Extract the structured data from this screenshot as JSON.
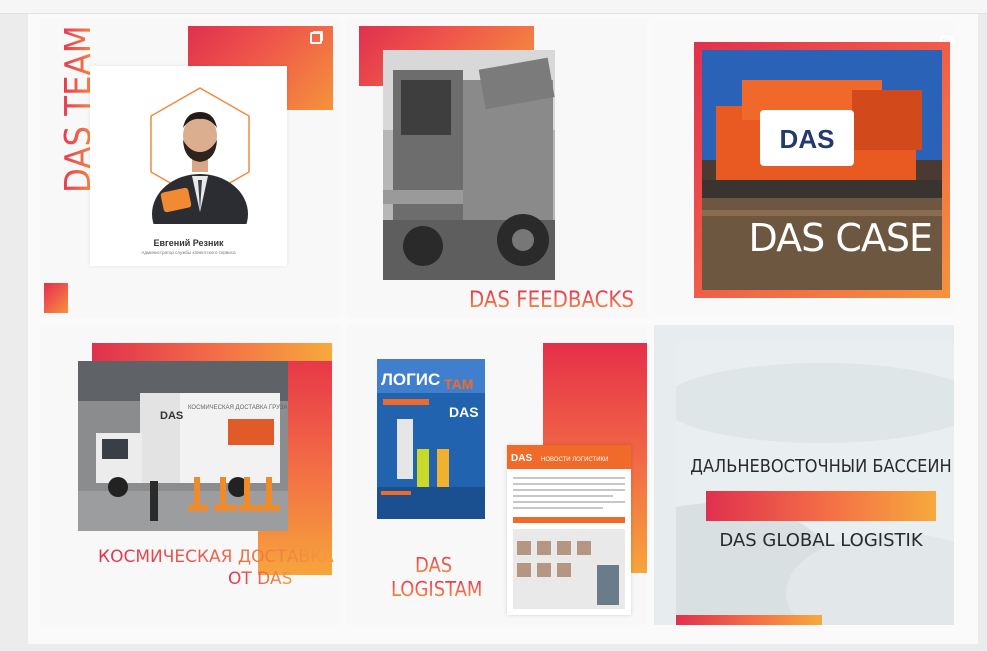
{
  "tiles": [
    {
      "title": "DAS TEAM",
      "person_name": "Евгений Резник",
      "person_role": "Администратор службы клиентского сервиса"
    },
    {
      "title": "DAS FEEDBACKS"
    },
    {
      "title": "DAS CASE",
      "banner_text": "DAS"
    },
    {
      "title_line1": "КОСМИЧЕСКАЯ ДОСТАВКА",
      "title_line2": "ОТ DAS",
      "truck_brand": "DAS",
      "truck_text": "КОСМИЧЕСКАЯ ДОСТАВКА ГРУЗА"
    },
    {
      "title_line1": "DAS",
      "title_line2": "LOGISTAM",
      "magazine_title_a": "ЛОГИС",
      "magazine_title_b": "ТАМ",
      "magazine_brand": "DAS",
      "news_brand": "DAS",
      "news_title": "НОВОСТИ ЛОГИСТИКИ"
    },
    {
      "line1": "ДАЛЬНЕВОСТОЧНЫИ БАССЕИН",
      "line2": "DAS GLOBAL LOGISTIK"
    }
  ],
  "colors": {
    "accent_red": "#e0304e",
    "accent_orange": "#f59b3c"
  },
  "icons": [
    "multiple-posts-icon",
    "multiple-posts-icon"
  ]
}
